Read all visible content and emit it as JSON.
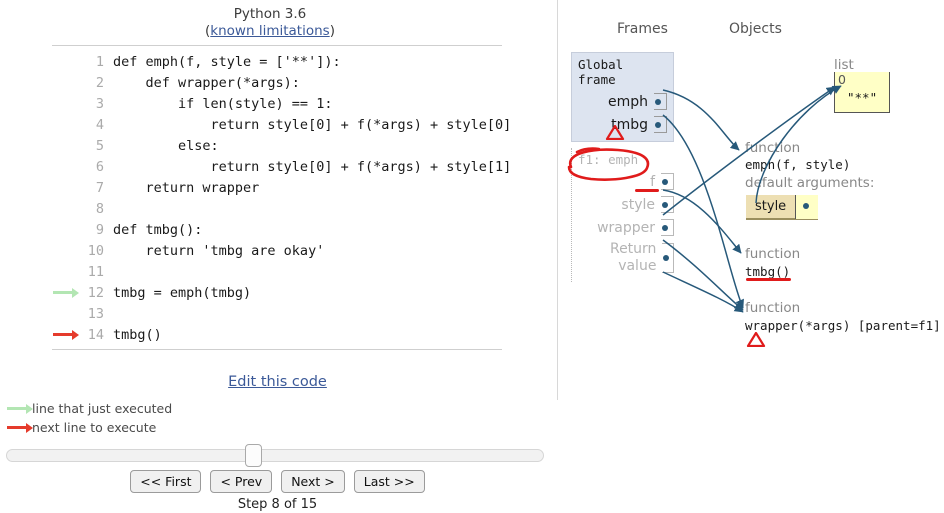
{
  "header": {
    "python_version": "Python 3.6",
    "limitations_prefix": "(",
    "limitations_link": "known limitations",
    "limitations_suffix": ")"
  },
  "code": {
    "lines": [
      {
        "no": "1",
        "text": "def emph(f, style = ['**']):",
        "marker": "none"
      },
      {
        "no": "2",
        "text": "    def wrapper(*args):",
        "marker": "none"
      },
      {
        "no": "3",
        "text": "        if len(style) == 1:",
        "marker": "none"
      },
      {
        "no": "4",
        "text": "            return style[0] + f(*args) + style[0]",
        "marker": "none"
      },
      {
        "no": "5",
        "text": "        else:",
        "marker": "none"
      },
      {
        "no": "6",
        "text": "            return style[0] + f(*args) + style[1]",
        "marker": "none"
      },
      {
        "no": "7",
        "text": "    return wrapper",
        "marker": "none"
      },
      {
        "no": "8",
        "text": "",
        "marker": "none"
      },
      {
        "no": "9",
        "text": "def tmbg():",
        "marker": "none"
      },
      {
        "no": "10",
        "text": "    return 'tmbg are okay'",
        "marker": "none"
      },
      {
        "no": "11",
        "text": "",
        "marker": "none"
      },
      {
        "no": "12",
        "text": "tmbg = emph(tmbg)",
        "marker": "green"
      },
      {
        "no": "13",
        "text": "",
        "marker": "none"
      },
      {
        "no": "14",
        "text": "tmbg()",
        "marker": "red"
      }
    ]
  },
  "controls": {
    "edit_link": "Edit this code",
    "legend_executed": "line that just executed",
    "legend_next": "next line to execute",
    "buttons": [
      "<< First",
      "< Prev",
      "Next >",
      "Last >>"
    ],
    "step_label": "Step 8 of 15"
  },
  "visualizer": {
    "frames_heading": "Frames",
    "objects_heading": "Objects",
    "frames": [
      {
        "title": "Global frame",
        "active": true,
        "vars": [
          "emph",
          "tmbg"
        ]
      },
      {
        "title": "f1: emph",
        "active": false,
        "vars": [
          "f",
          "style",
          "wrapper",
          "Return value"
        ]
      }
    ],
    "objects": {
      "list": {
        "type_label": "list",
        "index": "0",
        "value": "\"**\""
      },
      "function_emph": {
        "kind": "function",
        "signature": "emph(f, style)",
        "default_args_label": "default arguments:",
        "default_arg_key": "style"
      },
      "function_tmbg": {
        "kind": "function",
        "signature": "tmbg()"
      },
      "function_wrapper": {
        "kind": "function",
        "signature": "wrapper(*args) [parent=f1]"
      }
    }
  },
  "colors": {
    "pointer_blue": "#27597a",
    "annotation_red": "#e01b1b",
    "frame_bg": "#dde4f0",
    "object_yellow": "#ffffc6",
    "key_tan": "#eddfb3",
    "green_arrow": "#b3e6b3",
    "red_arrow": "#e53b2c"
  }
}
